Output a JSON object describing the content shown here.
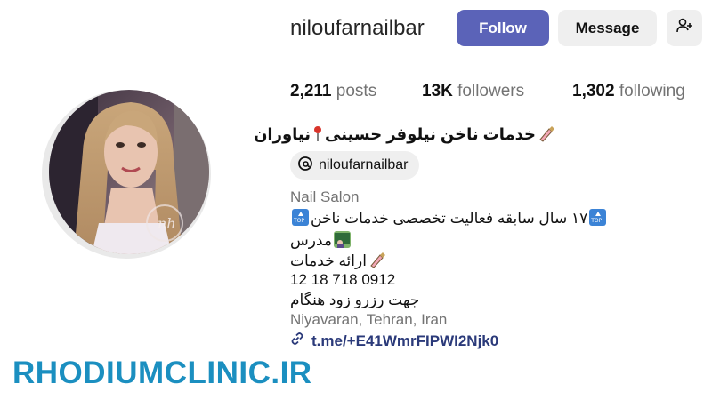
{
  "profile": {
    "username": "niloufarnailbar",
    "follow_label": "Follow",
    "message_label": "Message",
    "add_person_icon": "person-add-icon"
  },
  "stats": {
    "posts_count": "2,211",
    "posts_label": "posts",
    "followers_count": "13K",
    "followers_label": "followers",
    "following_count": "1,302",
    "following_label": "following"
  },
  "bio": {
    "name": "خدمات ناخن نیلوفر حسینی",
    "name_suffix": "نیاوران",
    "threads_handle": "niloufarnailbar",
    "category": "Nail Salon",
    "line1": "۱۷ سال سابقه فعالیت تخصصی خدمات ناخن",
    "line2": "مدرس",
    "line3": "ارائه خدمات",
    "phone": "12 18 718 0912",
    "line4": "جهت رزرو زود هنگام",
    "location": "Niyavaran, Tehran, Iran",
    "link": "t.me/+E41WmrFIPWI2Njk0"
  },
  "watermark": "RHODIUMCLINIC.IR",
  "colors": {
    "follow_button": "#5b63b8",
    "secondary_button": "#efefef",
    "watermark": "#1b8fc0",
    "link": "#2b3a7a",
    "muted_text": "#737373"
  }
}
